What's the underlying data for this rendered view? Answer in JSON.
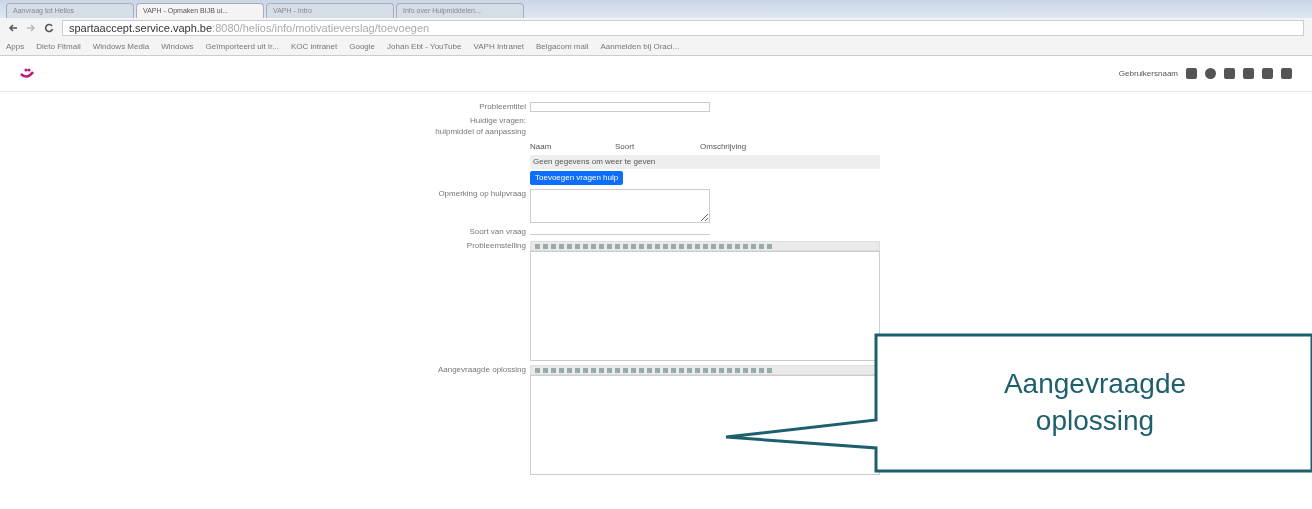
{
  "browser": {
    "tabs": [
      {
        "label": "Aanvraag tot Helios",
        "selected": false
      },
      {
        "label": "VAPH - Opmaken BIJB ui...",
        "selected": true
      },
      {
        "label": "VAPH - Intro",
        "selected": false
      },
      {
        "label": "Info over Hulpmiddelen...",
        "selected": false
      }
    ],
    "url_host": "spartaaccept.service.vaph.be",
    "url_path": ":8080/helios/info/motivatieverslag/toevoegen",
    "bookmarks": [
      "Apps",
      "Dieto Fitmail",
      "Windows Media",
      "Windows",
      "Geïmporteerd uit Ir...",
      "KOC intranet",
      "Google",
      "Johan Ebt - YouTube",
      "VAPH Intranet",
      "Belgacom mail",
      "Aanmelden bij Oraci..."
    ]
  },
  "app": {
    "user": "Gebruikersnaam"
  },
  "form": {
    "title_label": "Probleemtitel",
    "needs_label": "Huidige vragen: hulpmiddel of aanpassing",
    "columns": [
      "Naam",
      "Soort",
      "Omschrijving"
    ],
    "empty_row": "Geen gegevens om weer te geven",
    "add_button": "Toevoegen vragen hulp",
    "remark_label": "Opmerking op hulpvraag",
    "type_label": "Soort van vraag",
    "problem_label": "Probleemstelling",
    "solution_label": "Aangevraagde oplossing"
  },
  "callout": {
    "text": "Aangevraagde oplossing"
  }
}
